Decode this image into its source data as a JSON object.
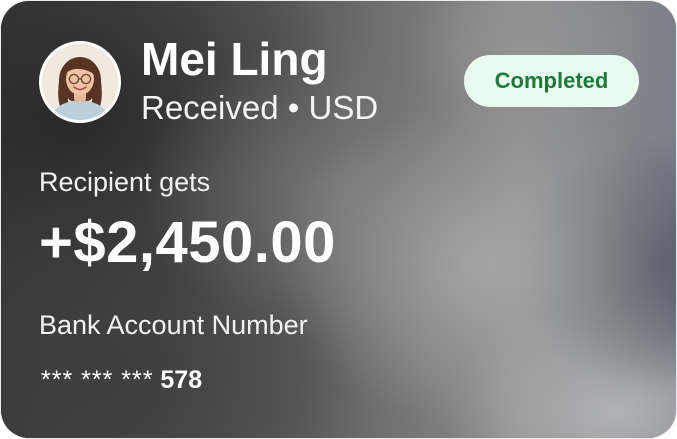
{
  "card": {
    "contact": {
      "name": "Mei Ling",
      "direction": "Received",
      "separator": "•",
      "currency": "USD",
      "avatar_icon": "person-avatar-photo"
    },
    "status": {
      "label": "Completed",
      "background_color": "#e9fbef",
      "text_color": "#1f7a3a"
    },
    "amount": {
      "label": "Recipient gets",
      "value": "+$2,450.00"
    },
    "bank": {
      "label": "Bank Account Number",
      "masked_prefix": "*** *** ***",
      "last_digits": "578"
    }
  }
}
